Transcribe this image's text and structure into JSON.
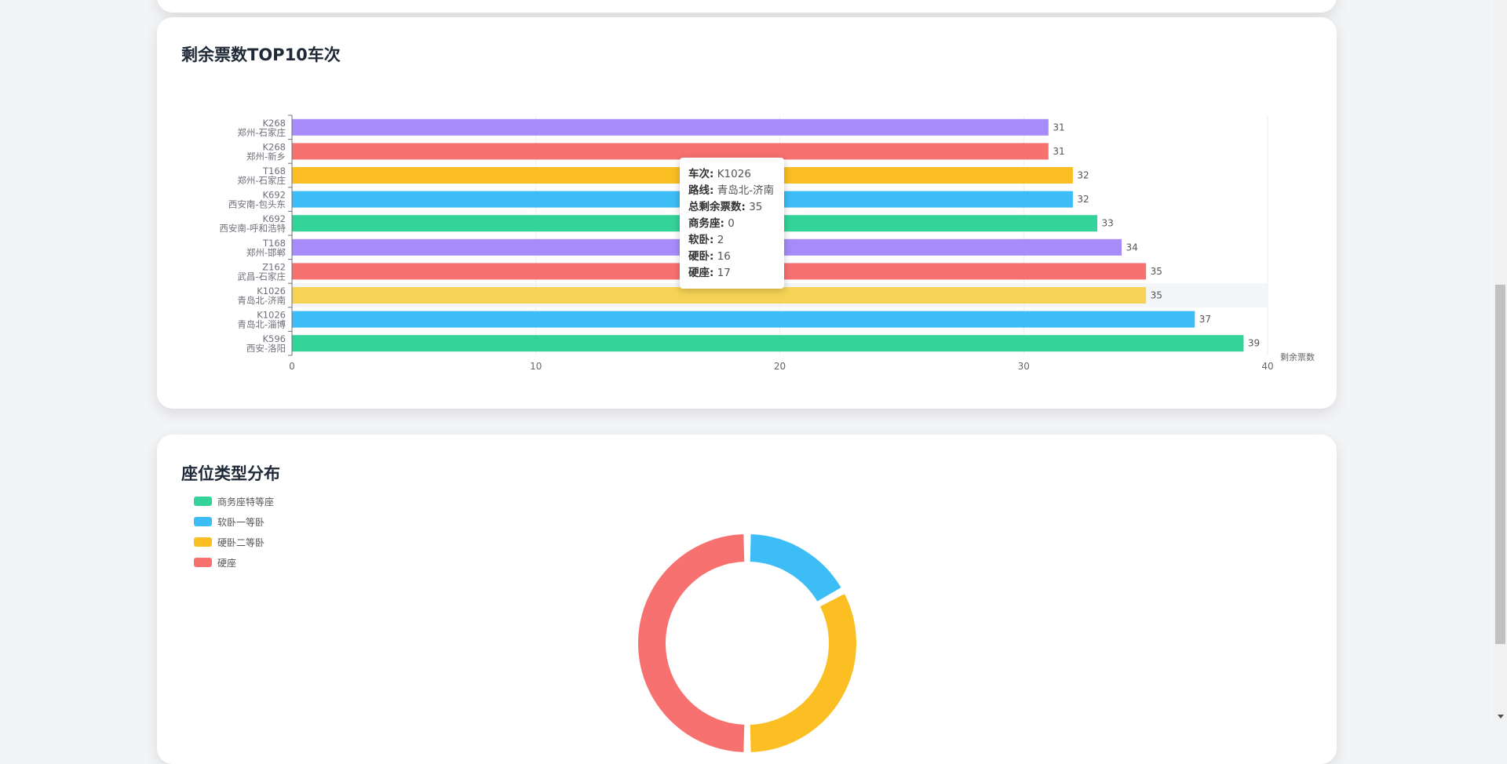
{
  "bar_card": {
    "title": "剩余票数TOP10车次"
  },
  "pie_card": {
    "title": "座位类型分布"
  },
  "tooltip": {
    "rows": [
      {
        "key": "车次:",
        "value": "K1026"
      },
      {
        "key": "路线:",
        "value": "青岛北-济南"
      },
      {
        "key": "总剩余票数:",
        "value": "35"
      },
      {
        "key": "商务座:",
        "value": "0"
      },
      {
        "key": "软卧:",
        "value": "2"
      },
      {
        "key": "硬卧:",
        "value": "16"
      },
      {
        "key": "硬座:",
        "value": "17"
      }
    ]
  },
  "colors": {
    "green": "#34d399",
    "blue": "#3dbdf5",
    "yellow": "#fbbf24",
    "red": "#f87171",
    "purple": "#a78bfa",
    "light_yellow": "#f6d354"
  },
  "chart_data": [
    {
      "type": "bar",
      "orientation": "horizontal",
      "title": "剩余票数TOP10车次",
      "xlabel": "剩余票数",
      "xlim": [
        0,
        40
      ],
      "xticks": [
        "0",
        "10",
        "20",
        "30",
        "40"
      ],
      "grid": true,
      "categories": [
        {
          "train": "K268",
          "route": "郑州-石家庄"
        },
        {
          "train": "K268",
          "route": "郑州-新乡"
        },
        {
          "train": "T168",
          "route": "郑州-石家庄"
        },
        {
          "train": "K692",
          "route": "西安南-包头东"
        },
        {
          "train": "K692",
          "route": "西安南-呼和浩特"
        },
        {
          "train": "T168",
          "route": "郑州-邯郸"
        },
        {
          "train": "Z162",
          "route": "武昌-石家庄"
        },
        {
          "train": "K1026",
          "route": "青岛北-济南"
        },
        {
          "train": "K1026",
          "route": "青岛北-淄博"
        },
        {
          "train": "K596",
          "route": "西安-洛阳"
        }
      ],
      "values": [
        31,
        31,
        32,
        32,
        33,
        34,
        35,
        35,
        37,
        39
      ],
      "value_labels": [
        "31",
        "31",
        "32",
        "32",
        "33",
        "34",
        "35",
        "35",
        "37",
        "39"
      ],
      "bar_colors": [
        "#a78bfa",
        "#f87171",
        "#fbbf24",
        "#3dbdf5",
        "#34d399",
        "#a78bfa",
        "#f87171",
        "#f6d354",
        "#3dbdf5",
        "#34d399"
      ],
      "highlighted_index": 7
    },
    {
      "type": "pie",
      "variant": "donut",
      "title": "座位类型分布",
      "legend_placement": "top-left",
      "labels": [
        "商务座特等座",
        "软卧一等卧",
        "硬卧二等卧",
        "硬座"
      ],
      "colors": [
        "#34d399",
        "#3dbdf5",
        "#fbbf24",
        "#f87171"
      ],
      "values": [
        0,
        17,
        33,
        50
      ]
    }
  ]
}
